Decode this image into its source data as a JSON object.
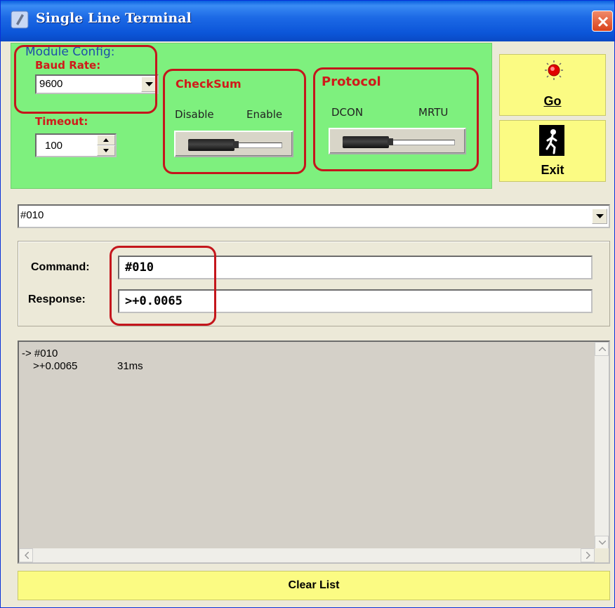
{
  "window": {
    "title": "Single Line Terminal"
  },
  "config": {
    "module_config_label": "Module Config:",
    "baud_rate_label": "Baud Rate:",
    "baud_rate_value": "9600",
    "timeout_label": "Timeout:",
    "timeout_value": "100"
  },
  "checksum": {
    "title": "CheckSum",
    "left_label": "Disable",
    "right_label": "Enable"
  },
  "protocol": {
    "title": "Protocol",
    "left_label": "DCON",
    "right_label": "MRTU"
  },
  "buttons": {
    "go_label": "Go",
    "exit_label": "Exit",
    "clear_label": "Clear List"
  },
  "command_combo": {
    "value": "#010"
  },
  "io": {
    "command_label": "Command:",
    "command_value": "#010",
    "response_label": "Response:",
    "response_value": ">+0.0065"
  },
  "log": {
    "sent": "-> #010",
    "received": ">+0.0065",
    "elapsed": "31ms"
  },
  "colors": {
    "config_panel": "#7ef07e",
    "button_yellow": "#fbfb83",
    "label_red": "#d01a1a",
    "callout_red": "#c4161c",
    "title_blue": "#0b55d8"
  },
  "icons": [
    "notepad-icon",
    "close-icon",
    "red-light-icon",
    "exit-person-icon",
    "chevron-down-icon",
    "spin-up-icon",
    "spin-down-icon"
  ]
}
